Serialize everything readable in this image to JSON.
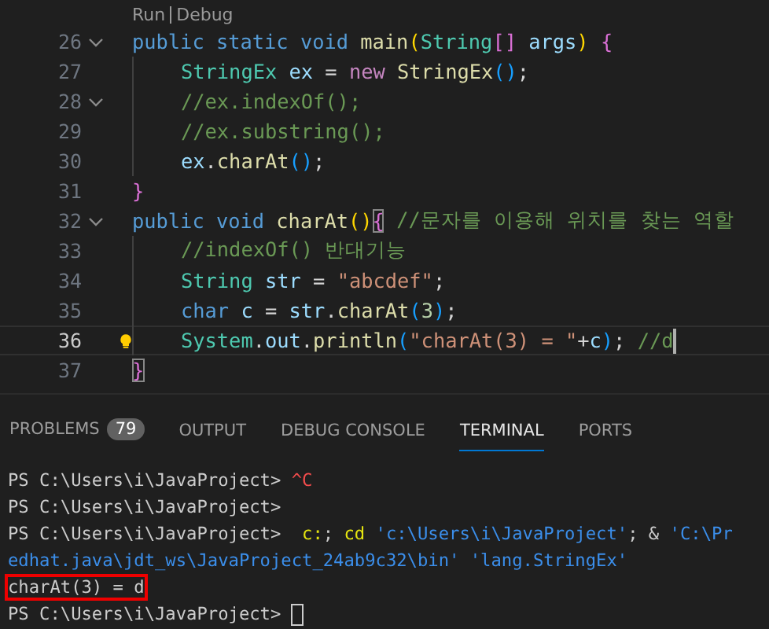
{
  "editor": {
    "codelens": [
      {
        "label": "Run"
      },
      {
        "label": "Debug"
      }
    ],
    "lines": [
      {
        "number": "26",
        "foldable": true,
        "nested": false,
        "active": false,
        "lightbulb": false,
        "cursor": false,
        "tokens": [
          {
            "kind": "keyword",
            "text": "public static void "
          },
          {
            "kind": "func",
            "text": "main"
          },
          {
            "kind": "bracket1",
            "text": "("
          },
          {
            "kind": "type",
            "text": "String"
          },
          {
            "kind": "bracket2",
            "text": "[]"
          },
          {
            "kind": "var",
            "text": " args"
          },
          {
            "kind": "bracket1",
            "text": ")"
          },
          {
            "kind": "bracket2",
            "text": " {"
          }
        ]
      },
      {
        "number": "27",
        "foldable": false,
        "nested": true,
        "active": false,
        "lightbulb": false,
        "cursor": false,
        "tokens": [
          {
            "kind": "type",
            "text": "StringEx"
          },
          {
            "kind": "var",
            "text": " ex"
          },
          {
            "kind": "plain",
            "text": " = "
          },
          {
            "kind": "control",
            "text": "new"
          },
          {
            "kind": "func",
            "text": " StringEx"
          },
          {
            "kind": "bracket3",
            "text": "()"
          },
          {
            "kind": "plain",
            "text": ";"
          }
        ]
      },
      {
        "number": "28",
        "foldable": true,
        "nested": true,
        "active": false,
        "lightbulb": false,
        "cursor": false,
        "tokens": [
          {
            "kind": "comment",
            "text": "//ex.indexOf();"
          }
        ]
      },
      {
        "number": "29",
        "foldable": false,
        "nested": true,
        "active": false,
        "lightbulb": false,
        "cursor": false,
        "tokens": [
          {
            "kind": "comment",
            "text": "//ex.substring();"
          }
        ]
      },
      {
        "number": "30",
        "foldable": false,
        "nested": true,
        "active": false,
        "lightbulb": false,
        "cursor": false,
        "tokens": [
          {
            "kind": "var",
            "text": "ex"
          },
          {
            "kind": "plain",
            "text": "."
          },
          {
            "kind": "func",
            "text": "charAt"
          },
          {
            "kind": "bracket3",
            "text": "()"
          },
          {
            "kind": "plain",
            "text": ";"
          }
        ]
      },
      {
        "number": "31",
        "foldable": false,
        "nested": false,
        "active": false,
        "lightbulb": false,
        "cursor": false,
        "tokens": [
          {
            "kind": "bracket2",
            "text": "}"
          }
        ]
      },
      {
        "number": "32",
        "foldable": true,
        "nested": false,
        "active": false,
        "lightbulb": false,
        "cursor": false,
        "tokens": [
          {
            "kind": "keyword",
            "text": "public void "
          },
          {
            "kind": "func",
            "text": "charAt"
          },
          {
            "kind": "bracket1",
            "text": "()"
          },
          {
            "kind": "matched",
            "text": "{"
          },
          {
            "kind": "comment",
            "text": " //문자를 이용해 위치를 찾는 역할"
          }
        ]
      },
      {
        "number": "33",
        "foldable": false,
        "nested": true,
        "active": false,
        "lightbulb": false,
        "cursor": false,
        "tokens": [
          {
            "kind": "comment",
            "text": "//indexOf() 반대기능"
          }
        ]
      },
      {
        "number": "34",
        "foldable": false,
        "nested": true,
        "active": false,
        "lightbulb": false,
        "cursor": false,
        "tokens": [
          {
            "kind": "type",
            "text": "String"
          },
          {
            "kind": "var",
            "text": " str"
          },
          {
            "kind": "plain",
            "text": " = "
          },
          {
            "kind": "string",
            "text": "\"abcdef\""
          },
          {
            "kind": "plain",
            "text": ";"
          }
        ]
      },
      {
        "number": "35",
        "foldable": false,
        "nested": true,
        "active": false,
        "lightbulb": false,
        "cursor": false,
        "tokens": [
          {
            "kind": "keyword",
            "text": "char"
          },
          {
            "kind": "var",
            "text": " c"
          },
          {
            "kind": "plain",
            "text": " = "
          },
          {
            "kind": "var",
            "text": "str"
          },
          {
            "kind": "plain",
            "text": "."
          },
          {
            "kind": "func",
            "text": "charAt"
          },
          {
            "kind": "bracket3",
            "text": "("
          },
          {
            "kind": "number",
            "text": "3"
          },
          {
            "kind": "bracket3",
            "text": ")"
          },
          {
            "kind": "plain",
            "text": ";"
          }
        ]
      },
      {
        "number": "36",
        "foldable": false,
        "nested": true,
        "active": true,
        "lightbulb": true,
        "cursor": true,
        "tokens": [
          {
            "kind": "type",
            "text": "System"
          },
          {
            "kind": "plain",
            "text": "."
          },
          {
            "kind": "var",
            "text": "out"
          },
          {
            "kind": "plain",
            "text": "."
          },
          {
            "kind": "func",
            "text": "println"
          },
          {
            "kind": "bracket3",
            "text": "("
          },
          {
            "kind": "string",
            "text": "\"charAt(3) = \""
          },
          {
            "kind": "plain",
            "text": "+"
          },
          {
            "kind": "var",
            "text": "c"
          },
          {
            "kind": "bracket3",
            "text": ")"
          },
          {
            "kind": "plain",
            "text": "; "
          },
          {
            "kind": "comment",
            "text": "//d"
          }
        ]
      },
      {
        "number": "37",
        "foldable": false,
        "nested": false,
        "active": false,
        "lightbulb": false,
        "cursor": false,
        "tokens": [
          {
            "kind": "matched",
            "text": "}"
          }
        ]
      }
    ]
  },
  "panel": {
    "tabs": [
      {
        "label": "PROBLEMS",
        "badge": "79",
        "selected": false
      },
      {
        "label": "OUTPUT",
        "selected": false
      },
      {
        "label": "DEBUG CONSOLE",
        "selected": false
      },
      {
        "label": "TERMINAL",
        "selected": true
      },
      {
        "label": "PORTS",
        "selected": false
      }
    ],
    "terminal": [
      {
        "cursor": false,
        "tokens": [
          {
            "kind": "plain",
            "text": "PS C:\\Users\\i\\JavaProject> "
          },
          {
            "kind": "error",
            "text": "^C"
          }
        ]
      },
      {
        "cursor": false,
        "tokens": [
          {
            "kind": "plain",
            "text": "PS C:\\Users\\i\\JavaProject>"
          }
        ]
      },
      {
        "cursor": false,
        "tokens": [
          {
            "kind": "plain",
            "text": "PS C:\\Users\\i\\JavaProject>  "
          },
          {
            "kind": "command",
            "text": "c:"
          },
          {
            "kind": "plain",
            "text": "; "
          },
          {
            "kind": "command",
            "text": "cd"
          },
          {
            "kind": "argument",
            "text": " 'c:\\Users\\i\\JavaProject'"
          },
          {
            "kind": "plain",
            "text": "; & "
          },
          {
            "kind": "argument",
            "text": "'C:\\Pr"
          }
        ]
      },
      {
        "cursor": false,
        "tokens": [
          {
            "kind": "argument",
            "text": "edhat.java\\jdt_ws\\JavaProject_24ab9c32\\bin' 'lang.StringEx'"
          }
        ]
      },
      {
        "cursor": false,
        "tokens": [
          {
            "kind": "boxed",
            "text": "charAt(3) = d"
          }
        ]
      },
      {
        "cursor": true,
        "tokens": [
          {
            "kind": "plain",
            "text": "PS C:\\Users\\i\\JavaProject> "
          }
        ]
      }
    ]
  }
}
